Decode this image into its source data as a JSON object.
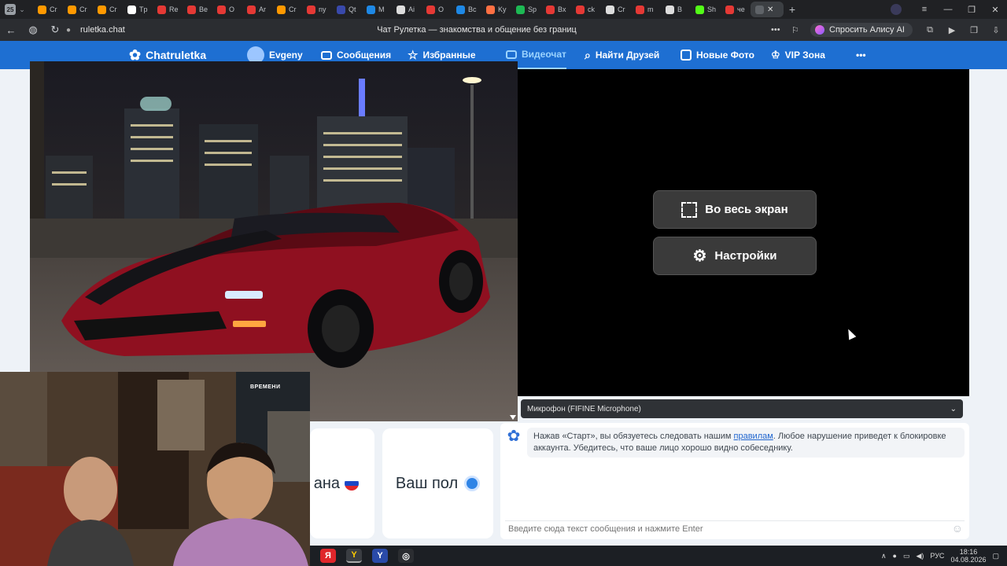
{
  "browser": {
    "tab_count_badge": "25",
    "tabs": [
      {
        "label": "Cr",
        "color": "#ff9900"
      },
      {
        "label": "Cr",
        "color": "#ff9900"
      },
      {
        "label": "Cr",
        "color": "#ff9900"
      },
      {
        "label": "Tp",
        "color": "#ffffff"
      },
      {
        "label": "Re",
        "color": "#e53935"
      },
      {
        "label": "Be",
        "color": "#e53935"
      },
      {
        "label": "O",
        "color": "#e53935"
      },
      {
        "label": "Ar",
        "color": "#e53935"
      },
      {
        "label": "Cr",
        "color": "#ff9900"
      },
      {
        "label": "ny",
        "color": "#e53935"
      },
      {
        "label": "Qt",
        "color": "#3949ab"
      },
      {
        "label": "M",
        "color": "#1e88e5"
      },
      {
        "label": "Ai",
        "color": "#dddddd"
      },
      {
        "label": "O",
        "color": "#e53935"
      },
      {
        "label": "Bc",
        "color": "#1e88e5"
      },
      {
        "label": "Ky",
        "color": "#ff7043"
      },
      {
        "label": "Sp",
        "color": "#1db954"
      },
      {
        "label": "Bx",
        "color": "#e53935"
      },
      {
        "label": "ck",
        "color": "#e53935"
      },
      {
        "label": "Cr",
        "color": "#dddddd"
      },
      {
        "label": "m",
        "color": "#e53935"
      },
      {
        "label": "B",
        "color": "#dddddd"
      },
      {
        "label": "Sh",
        "color": "#53fc18"
      },
      {
        "label": "чe",
        "color": "#e53935"
      }
    ],
    "url": "ruletka.chat",
    "page_title": "Чат Рулетка — знакомства и общение без границ",
    "alice_label": "Спросить Алису AI"
  },
  "nav": {
    "logo": "Chatruletka",
    "user": "Evgeny",
    "messages": "Сообщения",
    "favorites": "Избранные",
    "videochat": "Видеочат",
    "find_friends": "Найти Друзей",
    "new_photos": "Новые Фото",
    "vip": "VIP Зона",
    "more": "•••"
  },
  "video": {
    "fullscreen_label": "Во весь экран",
    "settings_label": "Настройки",
    "microphone": "Микрофон (FIFINE Microphone)"
  },
  "filters": {
    "country_label": "ана",
    "gender_label": "Ваш пол"
  },
  "chat": {
    "rules_prefix": "Нажав «Старт», вы обязуетесь следовать нашим ",
    "rules_link": "правилам",
    "rules_suffix": ". Любое нарушение приведет к блокировке аккаунта. Убедитесь, что ваше лицо хорошо видно собеседнику.",
    "input_placeholder": "Введите сюда текст сообщения и нажмите Enter"
  },
  "webcam": {
    "poster_text": "ВРЕМЕНИ"
  },
  "taskbar": {
    "apps": [
      "Я",
      "Y",
      "Y",
      "◎"
    ],
    "lang": "РУС",
    "time": "18:16",
    "date": "04.08.2026"
  }
}
